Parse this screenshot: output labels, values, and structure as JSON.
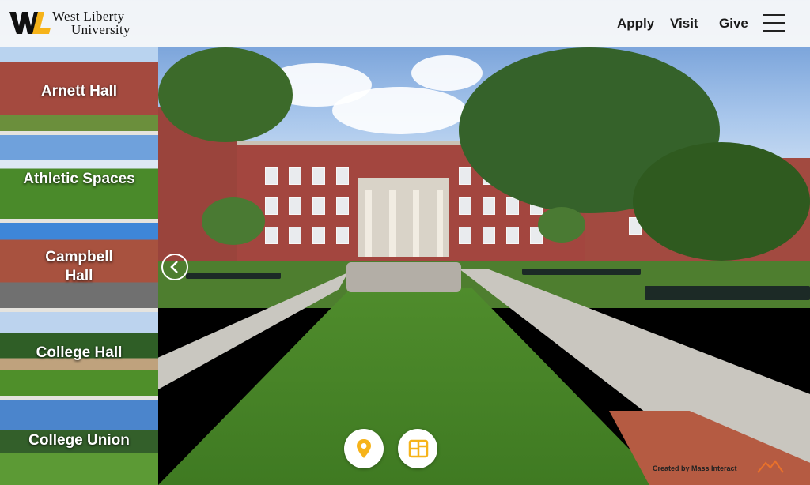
{
  "header": {
    "logo_line1": "West Liberty",
    "logo_line2": "University",
    "nav": [
      {
        "label": "Apply"
      },
      {
        "label": "Visit"
      },
      {
        "label": "Give"
      }
    ]
  },
  "sidebar": {
    "items": [
      {
        "label": "Arnett Hall"
      },
      {
        "label": "Athletic Spaces"
      },
      {
        "label": "Campbell Hall"
      },
      {
        "label": "College Hall"
      },
      {
        "label": "College Union"
      }
    ]
  },
  "controls": {
    "back_icon": "chevron-left-icon",
    "location_icon": "map-pin-icon",
    "floorplan_icon": "floorplan-icon"
  },
  "credit": "Created by Mass Interact",
  "colors": {
    "brand_gold": "#f6b31a",
    "brand_dark": "#111111"
  }
}
